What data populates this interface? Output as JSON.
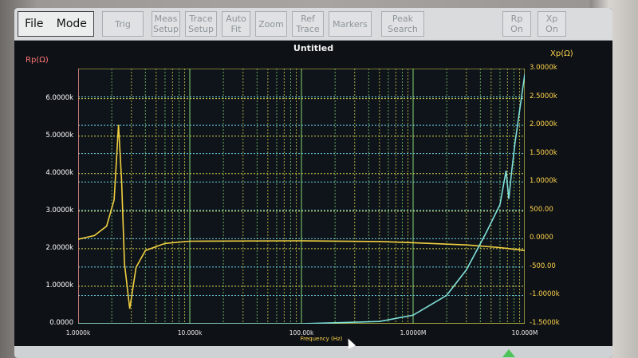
{
  "toolbar": {
    "file": "File",
    "mode": "Mode",
    "trig": "Trig",
    "meas_setup": "Meas\nSetup",
    "trace_setup": "Trace\nSetup",
    "auto_fit": "Auto\nFit",
    "zoom": "Zoom",
    "ref_trace": "Ref\nTrace",
    "markers": "Markers",
    "peak_search": "Peak\nSearch",
    "rp_on": "Rp\nOn",
    "xp_on": "Xp\nOn"
  },
  "plot": {
    "title": "Untitled",
    "left_axis_title": "Rp(Ω)",
    "right_axis_title": "Xp(Ω)",
    "xlabel": "Frequency (Hz)"
  },
  "colors": {
    "rp_trace": "#f0d040",
    "xp_trace": "#7fe0d8",
    "grid_major": "#d7d34a",
    "grid_cyan": "#6ad0e0",
    "grid_green": "#7fd070"
  },
  "chart_data": {
    "type": "line",
    "title": "Untitled",
    "xlabel": "Frequency (Hz)",
    "x_scale": "log",
    "xlim": [
      1000,
      10000000
    ],
    "x_tick_labels": [
      "1.0000k",
      "10.000k",
      "100.00k",
      "1.0000M",
      "10.000M"
    ],
    "y_left": {
      "label": "Rp(Ω)",
      "tick_labels": [
        "0.0000",
        "1.0000k",
        "2.0000k",
        "3.0000k",
        "4.0000k",
        "5.0000k",
        "6.0000k"
      ],
      "ylim": [
        0,
        6800
      ]
    },
    "y_right": {
      "label": "Xp(Ω)",
      "tick_labels": [
        "-1.5000k",
        "-1.0000k",
        "-500.00",
        "0.0000",
        "500.00",
        "1.0000k",
        "1.5000k",
        "2.0000k",
        "2.5000k",
        "3.0000k"
      ],
      "ylim": [
        -1500,
        3000
      ]
    },
    "series": [
      {
        "axis": "left",
        "x": [
          1000,
          1400,
          1800,
          2100,
          2300,
          2450,
          2600,
          2900,
          3300,
          4000,
          6000,
          10000,
          100000,
          500000,
          1000000,
          3000000,
          6000000,
          10000000
        ],
        "values": [
          2250,
          2350,
          2600,
          3300,
          5300,
          3800,
          1600,
          400,
          1500,
          1950,
          2140,
          2200,
          2210,
          2190,
          2160,
          2100,
          2030,
          1950
        ]
      },
      {
        "axis": "right",
        "x": [
          1000,
          10000,
          100000,
          500000,
          1000000,
          2000000,
          3000000,
          4500000,
          6000000,
          6800000,
          7200000,
          7600000,
          8200000,
          10000000
        ],
        "values": [
          -1500,
          -1500,
          -1500,
          -1460,
          -1350,
          -1000,
          -550,
          100,
          600,
          1200,
          700,
          1150,
          1700,
          2900
        ]
      }
    ]
  }
}
